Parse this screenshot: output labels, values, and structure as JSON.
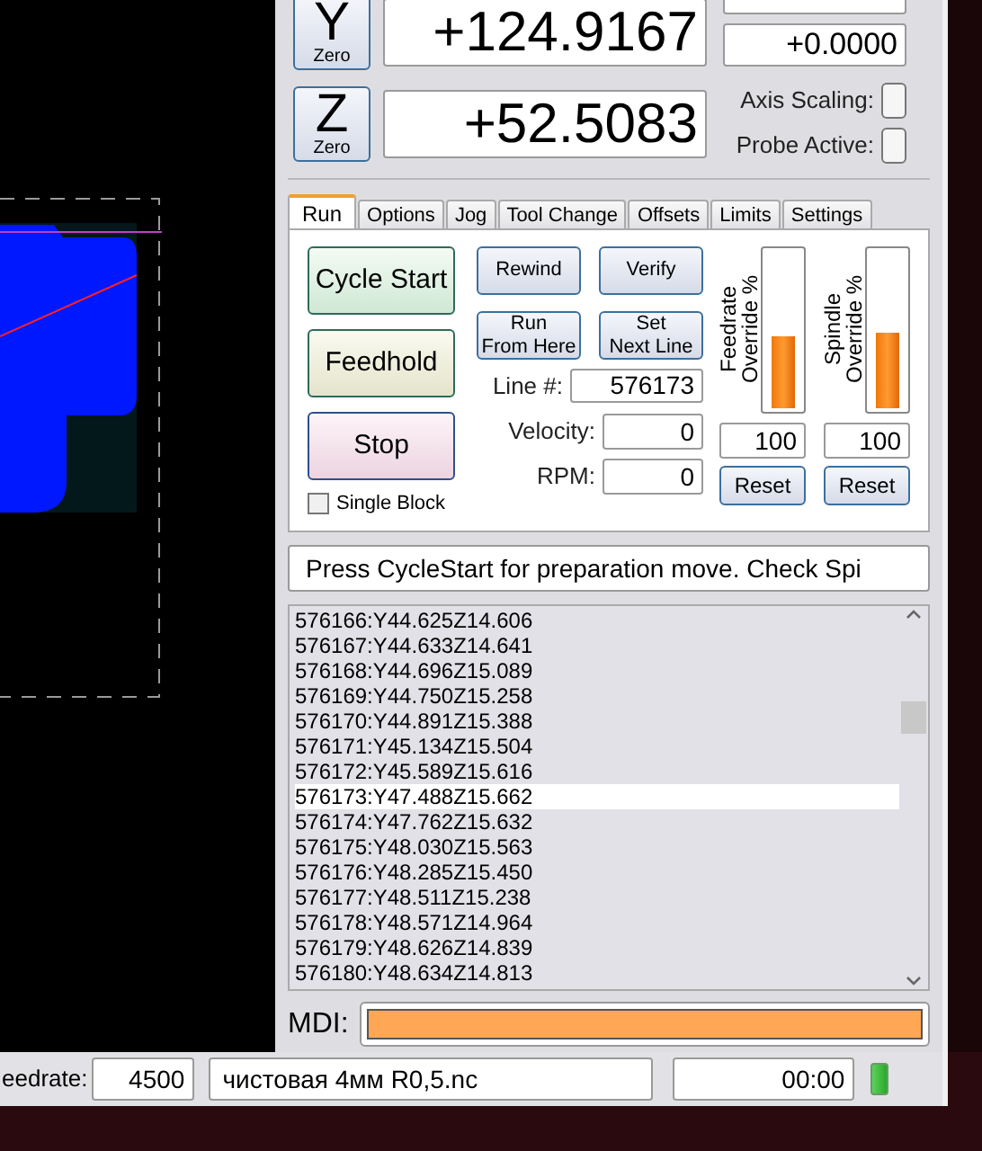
{
  "axes": [
    {
      "letter": "Y",
      "zero_label": "Zero",
      "value": "+124.9167"
    },
    {
      "letter": "Z",
      "zero_label": "Zero",
      "value": "+52.5083"
    }
  ],
  "offset_readout": "+0.0000",
  "axis_scaling": {
    "label": "Axis Scaling:",
    "checked": false
  },
  "probe_active": {
    "label": "Probe Active:",
    "checked": false
  },
  "tabs": [
    {
      "label": "Run",
      "selected": true
    },
    {
      "label": "Options",
      "selected": false
    },
    {
      "label": "Jog",
      "selected": false
    },
    {
      "label": "Tool Change",
      "selected": false
    },
    {
      "label": "Offsets",
      "selected": false
    },
    {
      "label": "Limits",
      "selected": false
    },
    {
      "label": "Settings",
      "selected": false
    }
  ],
  "run": {
    "cycle_start": "Cycle Start",
    "feedhold": "Feedhold",
    "stop": "Stop",
    "single_block": {
      "label": "Single Block",
      "checked": false
    },
    "rewind": "Rewind",
    "verify": "Verify",
    "run_from_here": [
      "Run",
      "From Here"
    ],
    "set_next_line": [
      "Set",
      "Next Line"
    ],
    "line_label": "Line #:",
    "line_value": "576173",
    "velocity_label": "Velocity:",
    "velocity_value": "0",
    "rpm_label": "RPM:",
    "rpm_value": "0",
    "overrides": [
      {
        "label": [
          "Feedrate",
          "Override %"
        ],
        "level": 0.46,
        "value": "100",
        "reset": "Reset"
      },
      {
        "label": [
          "Spindle",
          "Override %"
        ],
        "level": 0.48,
        "value": "100",
        "reset": "Reset"
      }
    ]
  },
  "message": "Press CycleStart for preparation move. Check Spi",
  "gcode_lines": [
    {
      "text": "576166:Y44.625Z14.606",
      "selected": false
    },
    {
      "text": "576167:Y44.633Z14.641",
      "selected": false
    },
    {
      "text": "576168:Y44.696Z15.089",
      "selected": false
    },
    {
      "text": "576169:Y44.750Z15.258",
      "selected": false
    },
    {
      "text": "576170:Y44.891Z15.388",
      "selected": false
    },
    {
      "text": "576171:Y45.134Z15.504",
      "selected": false
    },
    {
      "text": "576172:Y45.589Z15.616",
      "selected": false
    },
    {
      "text": "576173:Y47.488Z15.662",
      "selected": true
    },
    {
      "text": "576174:Y47.762Z15.632",
      "selected": false
    },
    {
      "text": "576175:Y48.030Z15.563",
      "selected": false
    },
    {
      "text": "576176:Y48.285Z15.450",
      "selected": false
    },
    {
      "text": "576177:Y48.511Z15.238",
      "selected": false
    },
    {
      "text": "576178:Y48.571Z14.964",
      "selected": false
    },
    {
      "text": "576179:Y48.626Z14.839",
      "selected": false
    },
    {
      "text": "576180:Y48.634Z14.813",
      "selected": false
    }
  ],
  "mdi": {
    "label": "MDI:"
  },
  "status_bar": {
    "feedrate_label": "eedrate:",
    "feedrate_value": "4500",
    "file": "чистовая 4мм R0,5.nc",
    "time": "00:00"
  }
}
